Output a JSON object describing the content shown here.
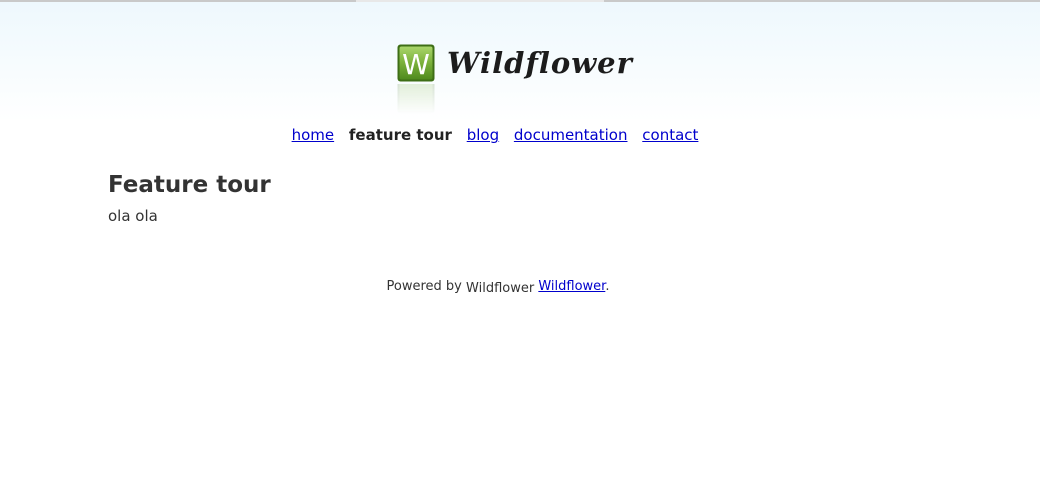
{
  "header": {
    "logo_text": "Wildflower",
    "logo_letter": "W"
  },
  "nav": {
    "items": [
      {
        "label": "home",
        "current": false
      },
      {
        "label": "feature tour",
        "current": true
      },
      {
        "label": "blog",
        "current": false
      },
      {
        "label": "documentation",
        "current": false
      },
      {
        "label": "contact",
        "current": false
      }
    ]
  },
  "main": {
    "title": "Feature tour",
    "body": "ola ola"
  },
  "footer": {
    "powered_by": "Powered by",
    "brand_text": "Wildflower",
    "link_label": "Wildflower",
    "end": "."
  },
  "colors": {
    "link": "#0000cc",
    "text": "#333333",
    "logo_green": "#7ab03a"
  }
}
